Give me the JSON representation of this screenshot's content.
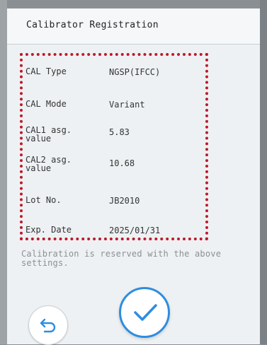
{
  "window": {
    "title": "Calibrator Registration"
  },
  "settings": {
    "cal_type": {
      "label": "CAL Type",
      "value": "NGSP(IFCC)"
    },
    "cal_mode": {
      "label": "CAL Mode",
      "value": "Variant"
    },
    "cal1": {
      "label_line1": "CAL1 asg.",
      "label_line2": "value",
      "value": "5.83"
    },
    "cal2": {
      "label_line1": "CAL2 asg.",
      "label_line2": "value",
      "value": "10.68"
    },
    "lot": {
      "label": "Lot No.",
      "value": "JB2010"
    },
    "exp": {
      "label": "Exp. Date",
      "value": "2025/01/31"
    }
  },
  "note": {
    "line1": "Calibration is reserved with the above",
    "line2": "settings."
  },
  "icons": {
    "back": "undo-arrow-icon",
    "confirm": "checkmark-icon"
  },
  "colors": {
    "accent": "#2e8de0",
    "highlight_frame": "#c0182a"
  }
}
